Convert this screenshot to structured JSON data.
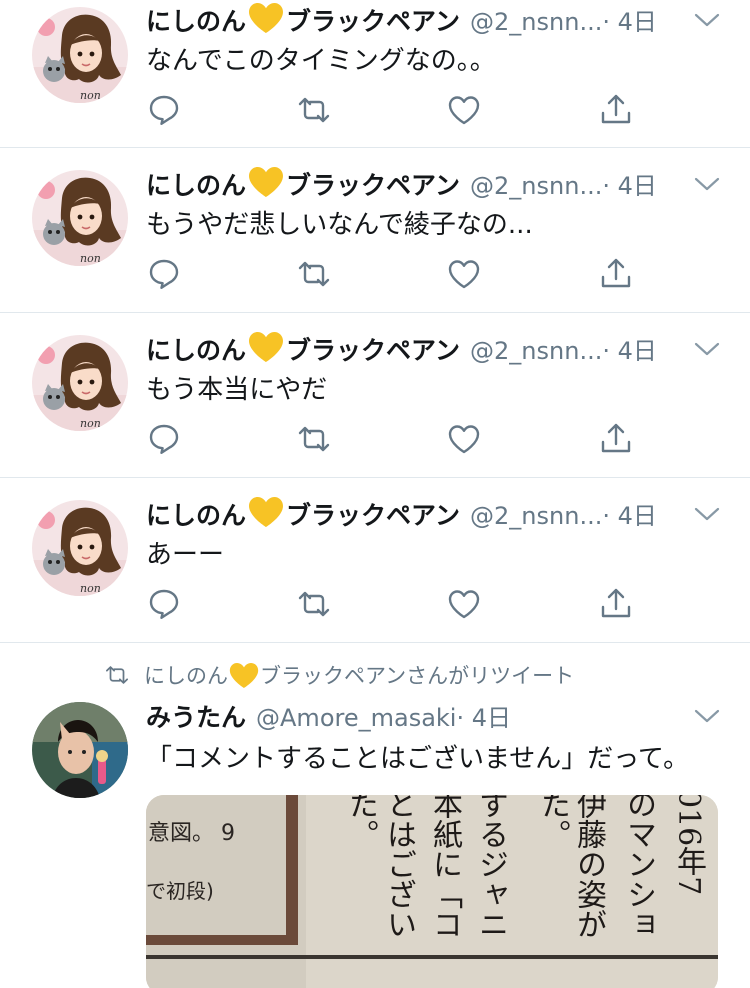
{
  "tweets": [
    {
      "name_a": "にしのん",
      "name_b": "ブラックペアン",
      "handle": "@2_nsnn...",
      "time": "· 4日",
      "text": "なんでこのタイミングなの。。"
    },
    {
      "name_a": "にしのん",
      "name_b": "ブラックペアン",
      "handle": "@2_nsnn...",
      "time": "· 4日",
      "text": "もうやだ悲しいなんで綾子なの..."
    },
    {
      "name_a": "にしのん",
      "name_b": "ブラックペアン",
      "handle": "@2_nsnn...",
      "time": "· 4日",
      "text": "もう本当にやだ"
    },
    {
      "name_a": "にしのん",
      "name_b": "ブラックペアン",
      "handle": "@2_nsnn...",
      "time": "· 4日",
      "text": "あーー"
    }
  ],
  "retweet": {
    "by_a": "にしのん",
    "by_b": "ブラックペアンさんがリツイート",
    "name": "みうたん",
    "handle": "@Amore_masaki",
    "time": "· 4日",
    "text": "「コメントすることはございません」だって。"
  },
  "newspaper": {
    "col1": "意図。 9",
    "col1b": "で初段)",
    "col2": "た。",
    "col3": "とはござい",
    "col4": "本紙に「コ",
    "col5": "するジャニ",
    "col6": "た。",
    "col7": "伊藤の姿が",
    "col8": "のマンショ",
    "col9": "016年7"
  },
  "colors": {
    "text": "#14171a",
    "muted": "#657786",
    "divider": "#e1e8ed",
    "heart": "#f7c325"
  }
}
